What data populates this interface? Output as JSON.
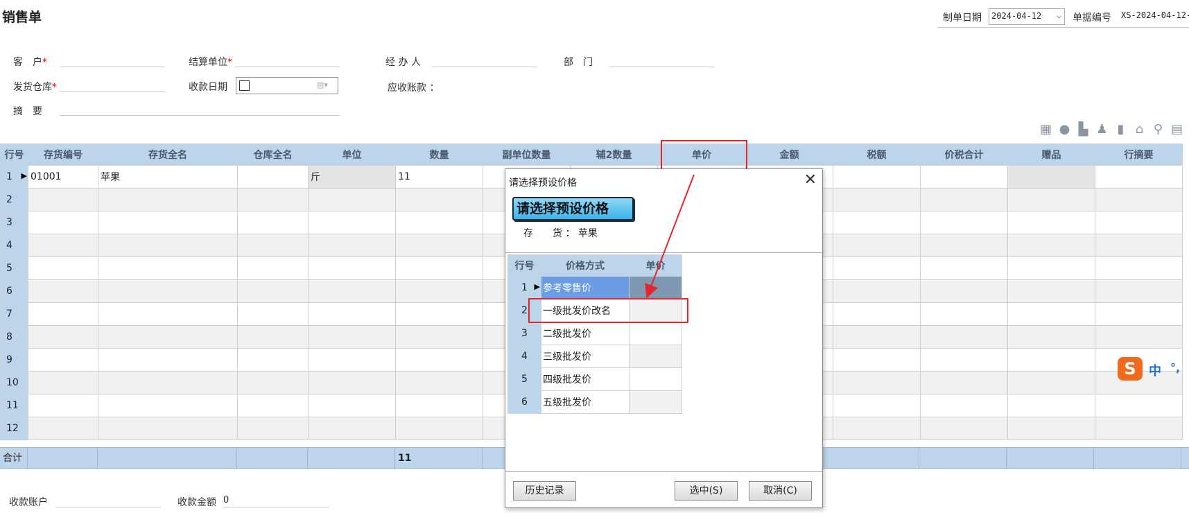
{
  "page": {
    "title": "销售单"
  },
  "header": {
    "date_label": "制单日期",
    "date_value": "2024-04-12",
    "docno_label": "单据编号",
    "docno_value": "XS-2024-04-12-"
  },
  "form": {
    "customer_label": "客　户",
    "settle_label": "结算单位",
    "handler_label": "经 办 人",
    "dept_label": "部　门",
    "warehouse_label": "发货仓库",
    "receipt_date_label": "收款日期",
    "receivable_label": "应收账款 ：",
    "summary_label": "摘　要",
    "required_mark": "*"
  },
  "grid": {
    "columns": [
      "行号",
      "存货编号",
      "存货全名",
      "仓库全名",
      "单位",
      "数量",
      "副单位数量",
      "辅2数量",
      "单价",
      "金额",
      "税额",
      "价税合计",
      "赠品",
      "行摘要"
    ],
    "rows": [
      [
        "1",
        "01001",
        "苹果",
        "",
        "斤",
        "11",
        "",
        "",
        "",
        "",
        "",
        "",
        "",
        ""
      ],
      [
        "2",
        "",
        "",
        "",
        "",
        "",
        "",
        "",
        "",
        "",
        "",
        "",
        "",
        ""
      ],
      [
        "3",
        "",
        "",
        "",
        "",
        "",
        "",
        "",
        "",
        "",
        "",
        "",
        "",
        ""
      ],
      [
        "4",
        "",
        "",
        "",
        "",
        "",
        "",
        "",
        "",
        "",
        "",
        "",
        "",
        ""
      ],
      [
        "5",
        "",
        "",
        "",
        "",
        "",
        "",
        "",
        "",
        "",
        "",
        "",
        "",
        ""
      ],
      [
        "6",
        "",
        "",
        "",
        "",
        "",
        "",
        "",
        "",
        "",
        "",
        "",
        "",
        ""
      ],
      [
        "7",
        "",
        "",
        "",
        "",
        "",
        "",
        "",
        "",
        "",
        "",
        "",
        "",
        ""
      ],
      [
        "8",
        "",
        "",
        "",
        "",
        "",
        "",
        "",
        "",
        "",
        "",
        "",
        "",
        ""
      ],
      [
        "9",
        "",
        "",
        "",
        "",
        "",
        "",
        "",
        "",
        "",
        "",
        "",
        "",
        ""
      ],
      [
        "10",
        "",
        "",
        "",
        "",
        "",
        "",
        "",
        "",
        "",
        "",
        "",
        "",
        ""
      ],
      [
        "11",
        "",
        "",
        "",
        "",
        "",
        "",
        "",
        "",
        "",
        "",
        "",
        "",
        ""
      ],
      [
        "12",
        "",
        "",
        "",
        "",
        "",
        "",
        "",
        "",
        "",
        "",
        "",
        "",
        ""
      ]
    ],
    "total_label": "合计",
    "total_qty": "11"
  },
  "footer": {
    "account_label": "收款账户",
    "amount_label": "收款金额",
    "amount_value": "0"
  },
  "dialog": {
    "window_title": "请选择预设价格",
    "banner": "请选择预设价格",
    "stock_label": "存　　货 ：",
    "stock_value": "苹果",
    "columns": [
      "行号",
      "价格方式",
      "单价"
    ],
    "rows": [
      [
        "1",
        "参考零售价",
        ""
      ],
      [
        "2",
        "一级批发价改名",
        ""
      ],
      [
        "3",
        "二级批发价",
        ""
      ],
      [
        "4",
        "三级批发价",
        ""
      ],
      [
        "5",
        "四级批发价",
        ""
      ],
      [
        "6",
        "五级批发价",
        ""
      ]
    ],
    "history_button": "历史记录",
    "select_button": "选中(S)",
    "cancel_button": "取消(C)"
  },
  "ime": {
    "mode": "中",
    "punct": "°,"
  },
  "colors": {
    "header_bg": "#bcd5eb",
    "highlight": "#e8242b",
    "selected_row": "#6a9de3"
  }
}
